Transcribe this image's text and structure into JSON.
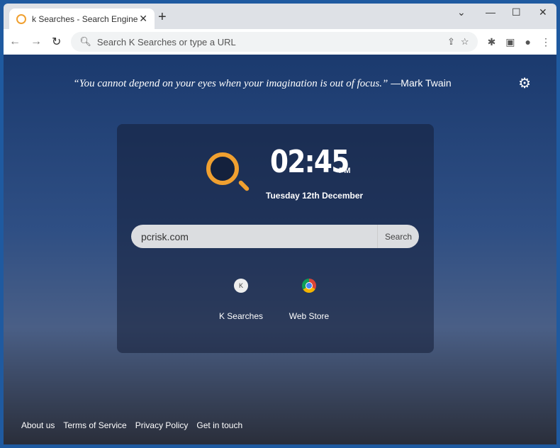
{
  "browser": {
    "tab_title": "k Searches - Search Engine",
    "omnibox_placeholder": "Search K Searches or type a URL"
  },
  "quote": {
    "text": "“You cannot depend on your eyes when your imagination is out of focus.”",
    "author": " —Mark Twain"
  },
  "clock": {
    "time": "02:45",
    "ampm": "PM",
    "date": "Tuesday 12th December"
  },
  "search": {
    "value": "pcrisk.com",
    "button": "Search"
  },
  "shortcuts": [
    {
      "label": "K Searches",
      "icon": "K"
    },
    {
      "label": "Web Store"
    }
  ],
  "footer": [
    "About us",
    "Terms of Service",
    "Privacy Policy",
    "Get in touch"
  ]
}
